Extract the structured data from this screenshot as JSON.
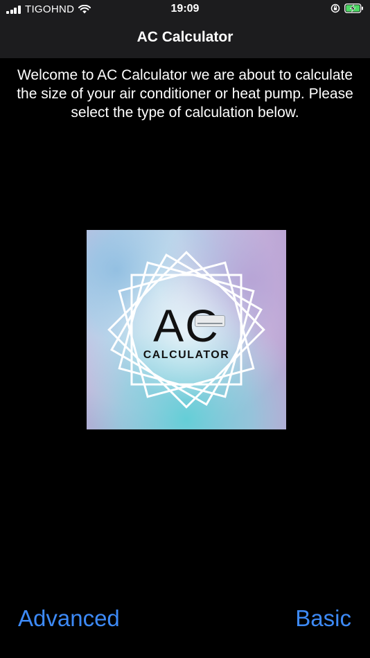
{
  "status_bar": {
    "carrier": "TIGOHND",
    "time": "19:09",
    "icons": [
      "signal-icon",
      "wifi-icon",
      "orientation-lock-icon",
      "battery-charging-icon"
    ]
  },
  "nav": {
    "title": "AC Calculator"
  },
  "main": {
    "welcome_text": "Welcome to AC Calculator we are about to calculate the size of your air conditioner or heat pump. Please select the type of calculation below.",
    "logo": {
      "title": "AC",
      "subtitle": "CALCULATOR"
    }
  },
  "actions": {
    "advanced_label": "Advanced",
    "basic_label": "Basic"
  },
  "colors": {
    "background": "#000000",
    "bar": "#1c1c1e",
    "accent": "#3d8af7",
    "text": "#ffffff",
    "battery": "#4cd964"
  }
}
